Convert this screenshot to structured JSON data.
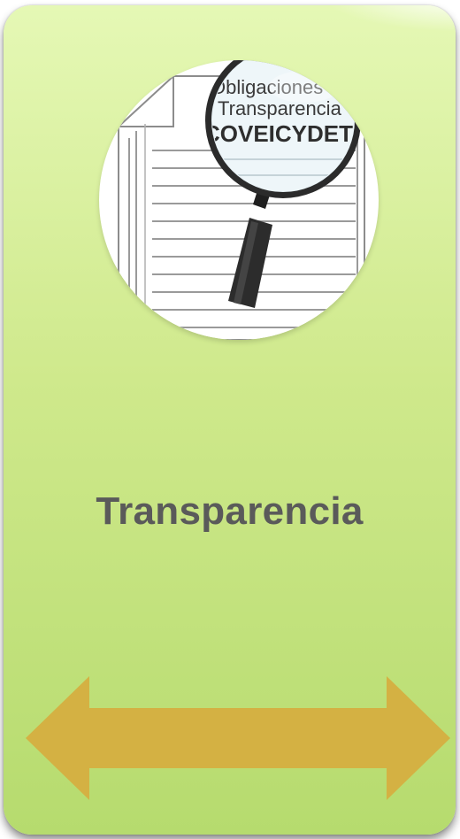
{
  "card": {
    "title": "Transparencia",
    "colors": {
      "card_top": "#e5f8b5",
      "card_bottom": "#b6db6e",
      "title_text": "#5a5a5a",
      "arrow_fill": "#d4b143"
    }
  },
  "thumbnail": {
    "icon": "magnifier-over-document-icon",
    "lens_line1": "Obligaciones de",
    "lens_line2": "Transparencia",
    "lens_line3": "COVEICYDET"
  },
  "navigation": {
    "icon": "double-headed-arrow-icon"
  }
}
